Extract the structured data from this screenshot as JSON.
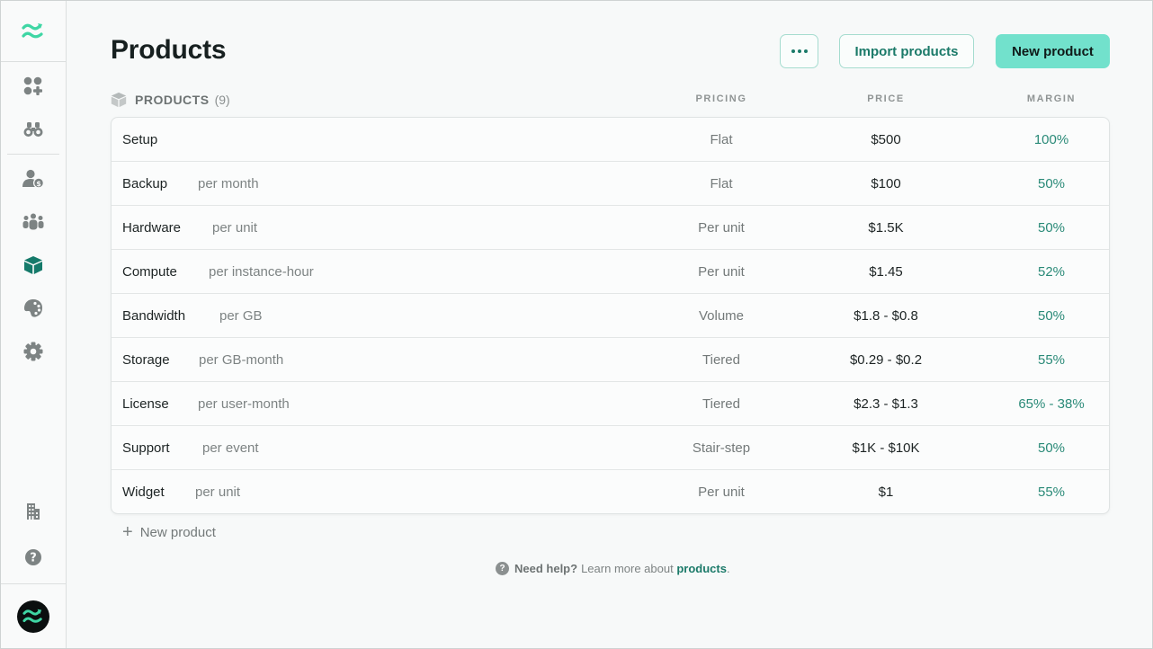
{
  "sidebar": {
    "items": [
      {
        "name": "dashboards",
        "icon": "widgets-icon"
      },
      {
        "name": "explore",
        "icon": "binoculars-icon"
      },
      {
        "name": "customers",
        "icon": "user-dollar-icon"
      },
      {
        "name": "teams",
        "icon": "users-group-icon"
      },
      {
        "name": "products",
        "icon": "cube-icon",
        "active": true
      },
      {
        "name": "themes",
        "icon": "palette-icon"
      },
      {
        "name": "settings",
        "icon": "gear-icon"
      },
      {
        "name": "company",
        "icon": "building-icon"
      },
      {
        "name": "help",
        "icon": "question-icon"
      }
    ],
    "brand_color": "#3fd6a4",
    "active_color": "#157a6a"
  },
  "header": {
    "title": "Products",
    "more_label": "More options",
    "import_label": "Import products",
    "new_label": "New product"
  },
  "section": {
    "title": "PRODUCTS",
    "count": "(9)"
  },
  "columns": {
    "pricing": "PRICING",
    "price": "PRICE",
    "margin": "MARGIN"
  },
  "products": [
    {
      "name": "Setup",
      "unit": "",
      "pricing": "Flat",
      "price": "$500",
      "margin": "100%"
    },
    {
      "name": "Backup",
      "unit": "per month",
      "pricing": "Flat",
      "price": "$100",
      "margin": "50%"
    },
    {
      "name": "Hardware",
      "unit": "per unit",
      "pricing": "Per unit",
      "price": "$1.5K",
      "margin": "50%"
    },
    {
      "name": "Compute",
      "unit": "per instance-hour",
      "pricing": "Per unit",
      "price": "$1.45",
      "margin": "52%"
    },
    {
      "name": "Bandwidth",
      "unit": "per GB",
      "pricing": "Volume",
      "price": "$1.8 - $0.8",
      "margin": "50%"
    },
    {
      "name": "Storage",
      "unit": "per GB-month",
      "pricing": "Tiered",
      "price": "$0.29 - $0.2",
      "margin": "55%"
    },
    {
      "name": "License",
      "unit": "per user-month",
      "pricing": "Tiered",
      "price": "$2.3 - $1.3",
      "margin": "65% - 38%"
    },
    {
      "name": "Support",
      "unit": "per event",
      "pricing": "Stair-step",
      "price": "$1K - $10K",
      "margin": "50%"
    },
    {
      "name": "Widget",
      "unit": "per unit",
      "pricing": "Per unit",
      "price": "$1",
      "margin": "55%"
    }
  ],
  "add_row_label": "New product",
  "help": {
    "bold": "Need help?",
    "text": "Learn more about",
    "link": "products",
    "end": "."
  }
}
